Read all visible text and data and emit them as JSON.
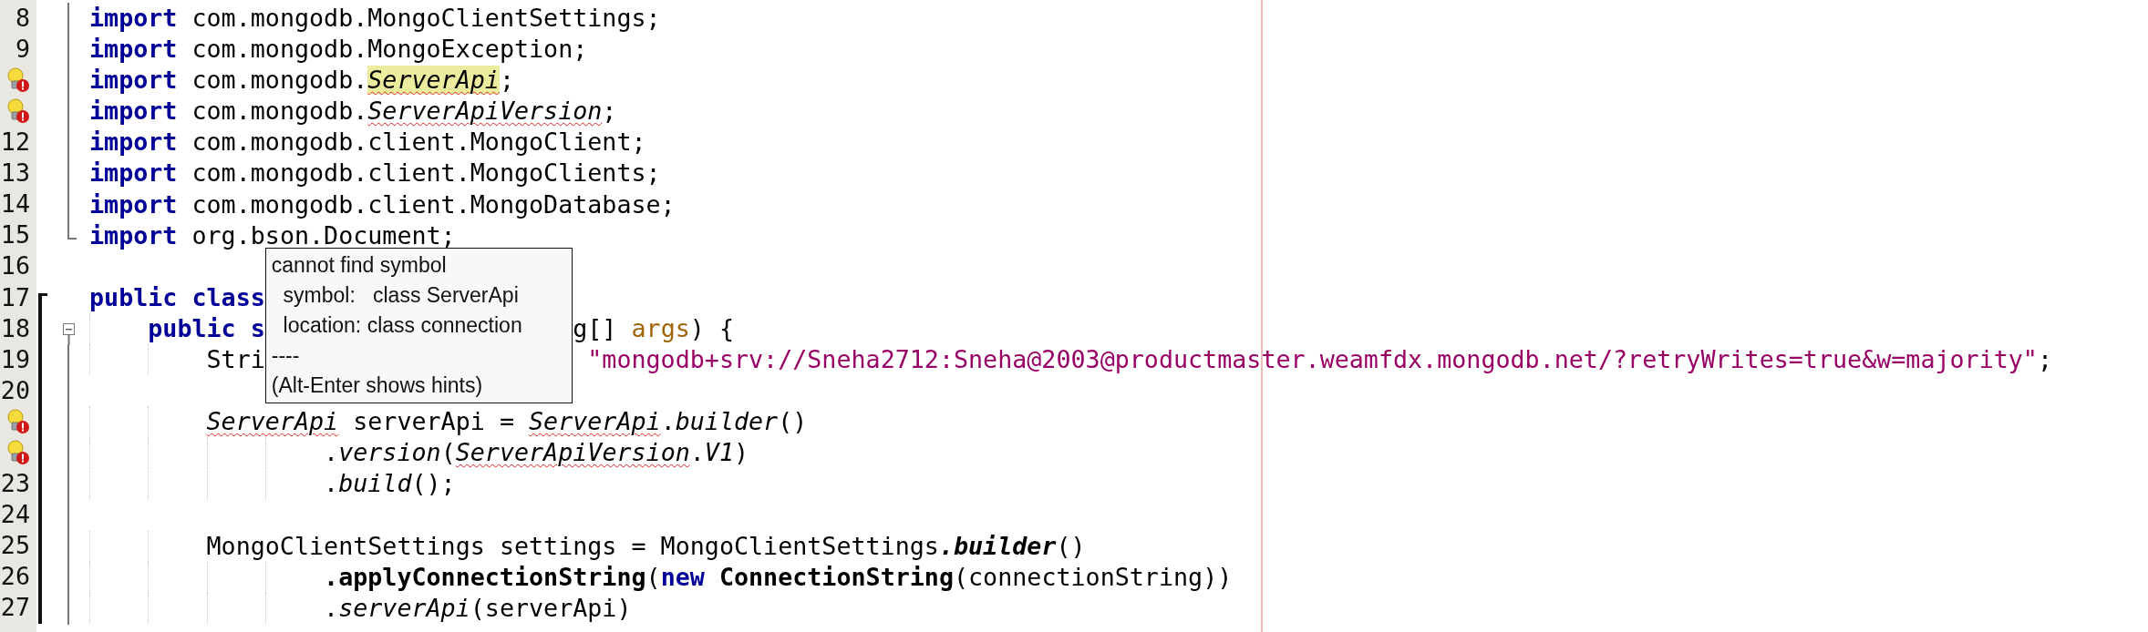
{
  "editor": {
    "lines": [
      {
        "number": "8",
        "error_hint": false,
        "fold_guide": true,
        "fold_end": false,
        "fold_toggle": false,
        "in_scope": false,
        "scope_start": false,
        "tokens": [
          {
            "kind": "kw",
            "text": "import"
          },
          {
            "kind": "plain",
            "text": " com.mongodb.MongoClientSettings;"
          }
        ]
      },
      {
        "number": "9",
        "error_hint": false,
        "fold_guide": true,
        "fold_end": false,
        "fold_toggle": false,
        "in_scope": false,
        "scope_start": false,
        "tokens": [
          {
            "kind": "kw",
            "text": "import"
          },
          {
            "kind": "plain",
            "text": " com.mongodb.MongoException;"
          }
        ]
      },
      {
        "error_hint": true,
        "fold_guide": true,
        "fold_end": false,
        "fold_toggle": false,
        "in_scope": false,
        "scope_start": false,
        "tokens": [
          {
            "kind": "kw",
            "text": "import"
          },
          {
            "kind": "plain",
            "text": " com.mongodb."
          },
          {
            "kind": "err_hl",
            "text": "ServerApi"
          },
          {
            "kind": "plain",
            "text": ";"
          }
        ]
      },
      {
        "error_hint": true,
        "fold_guide": true,
        "fold_end": false,
        "fold_toggle": false,
        "in_scope": false,
        "scope_start": false,
        "tokens": [
          {
            "kind": "kw",
            "text": "import"
          },
          {
            "kind": "plain",
            "text": " com.mongodb."
          },
          {
            "kind": "err",
            "text": "ServerApiVersion"
          },
          {
            "kind": "plain",
            "text": ";"
          }
        ]
      },
      {
        "number": "12",
        "error_hint": false,
        "fold_guide": true,
        "fold_end": false,
        "fold_toggle": false,
        "in_scope": false,
        "scope_start": false,
        "tokens": [
          {
            "kind": "kw",
            "text": "import"
          },
          {
            "kind": "plain",
            "text": " com.mongodb.client.MongoClient;"
          }
        ]
      },
      {
        "number": "13",
        "error_hint": false,
        "fold_guide": true,
        "fold_end": false,
        "fold_toggle": false,
        "in_scope": false,
        "scope_start": false,
        "tokens": [
          {
            "kind": "kw",
            "text": "import"
          },
          {
            "kind": "plain",
            "text": " com.mongodb.client.MongoClients;"
          }
        ]
      },
      {
        "number": "14",
        "error_hint": false,
        "fold_guide": true,
        "fold_end": false,
        "fold_toggle": false,
        "in_scope": false,
        "scope_start": false,
        "tokens": [
          {
            "kind": "kw",
            "text": "import"
          },
          {
            "kind": "plain",
            "text": " com.mongodb.client.MongoDatabase;"
          }
        ]
      },
      {
        "number": "15",
        "error_hint": false,
        "fold_guide": false,
        "fold_end": true,
        "fold_toggle": false,
        "in_scope": false,
        "scope_start": false,
        "tokens": [
          {
            "kind": "kw",
            "text": "import"
          },
          {
            "kind": "plain",
            "text": " org.bson.Document;"
          }
        ]
      },
      {
        "number": "16",
        "error_hint": false,
        "fold_guide": false,
        "fold_end": false,
        "fold_toggle": false,
        "in_scope": false,
        "scope_start": false
      },
      {
        "number": "17",
        "error_hint": false,
        "fold_guide": false,
        "fold_end": false,
        "fold_toggle": false,
        "in_scope": false,
        "scope_start": true,
        "tokens": [
          {
            "kind": "kw",
            "text": "public"
          },
          {
            "kind": "kw",
            "text": " class"
          }
        ]
      },
      {
        "number": "18",
        "error_hint": false,
        "fold_guide": false,
        "fold_end": false,
        "fold_toggle": true,
        "in_scope": true,
        "scope_start": false,
        "tokens": [
          {
            "kind": "kw",
            "text": "    public"
          },
          {
            "kind": "kw",
            "text": " s"
          }
        ],
        "tokens_after_tooltip": [
          {
            "kind": "plain",
            "text": "g[] "
          },
          {
            "kind": "param",
            "text": "args"
          },
          {
            "kind": "plain",
            "text": ") {"
          }
        ]
      },
      {
        "number": "19",
        "error_hint": false,
        "fold_guide": true,
        "fold_end": false,
        "fold_toggle": false,
        "in_scope": true,
        "scope_start": false,
        "tokens": [
          {
            "kind": "plain",
            "text": "        Stri"
          }
        ],
        "tokens_after_tooltip": [
          {
            "kind": "str",
            "text": " \"mongodb+srv://Sneha2712:Sneha@2003@productmaster.weamfdx.mongodb.net/?retryWrites=true&w=majority\""
          },
          {
            "kind": "plain",
            "text": ";"
          }
        ]
      },
      {
        "number": "20",
        "error_hint": false,
        "fold_guide": true,
        "fold_end": false,
        "fold_toggle": false,
        "in_scope": true,
        "scope_start": false
      },
      {
        "error_hint": true,
        "fold_guide": true,
        "fold_end": false,
        "fold_toggle": false,
        "in_scope": true,
        "scope_start": false,
        "tokens": [
          {
            "kind": "err",
            "text": "        ServerApi"
          },
          {
            "kind": "plain",
            "text": " serverApi = "
          },
          {
            "kind": "err",
            "text": "ServerApi"
          },
          {
            "kind": "plain",
            "text": "."
          },
          {
            "kind": "italic",
            "text": "builder"
          },
          {
            "kind": "plain",
            "text": "()"
          }
        ]
      },
      {
        "error_hint": true,
        "fold_guide": true,
        "fold_end": false,
        "fold_toggle": false,
        "in_scope": true,
        "scope_start": false,
        "tokens": [
          {
            "kind": "plain",
            "text": "                ."
          },
          {
            "kind": "italic",
            "text": "version"
          },
          {
            "kind": "plain",
            "text": "("
          },
          {
            "kind": "err",
            "text": "ServerApiVersion"
          },
          {
            "kind": "plain",
            "text": "."
          },
          {
            "kind": "italic",
            "text": "V1"
          },
          {
            "kind": "plain",
            "text": ")"
          }
        ]
      },
      {
        "number": "23",
        "error_hint": false,
        "fold_guide": true,
        "fold_end": false,
        "fold_toggle": false,
        "in_scope": true,
        "scope_start": false,
        "tokens": [
          {
            "kind": "plain",
            "text": "                ."
          },
          {
            "kind": "italic",
            "text": "build"
          },
          {
            "kind": "plain",
            "text": "();"
          }
        ]
      },
      {
        "number": "24",
        "error_hint": false,
        "fold_guide": true,
        "fold_end": false,
        "fold_toggle": false,
        "in_scope": true,
        "scope_start": false
      },
      {
        "number": "25",
        "error_hint": false,
        "fold_guide": true,
        "fold_end": false,
        "fold_toggle": false,
        "in_scope": true,
        "scope_start": false,
        "tokens": [
          {
            "kind": "plain",
            "text": "        MongoClientSettings settings = MongoClientSettings"
          },
          {
            "kind": "bolditalic",
            "text": ".builder"
          },
          {
            "kind": "plain",
            "text": "()"
          }
        ]
      },
      {
        "number": "26",
        "error_hint": false,
        "fold_guide": true,
        "fold_end": false,
        "fold_toggle": false,
        "in_scope": true,
        "scope_start": false,
        "tokens": [
          {
            "kind": "bold",
            "text": "                .applyConnectionString"
          },
          {
            "kind": "plain",
            "text": "("
          },
          {
            "kind": "kw",
            "text": "new"
          },
          {
            "kind": "bold",
            "text": " ConnectionString"
          },
          {
            "kind": "plain",
            "text": "(connectionString))"
          }
        ]
      },
      {
        "number": "27",
        "error_hint": false,
        "fold_guide": true,
        "fold_end": false,
        "fold_toggle": false,
        "in_scope": true,
        "scope_start": false,
        "tokens": [
          {
            "kind": "plain",
            "text": "                ."
          },
          {
            "kind": "italic",
            "text": "serverApi"
          },
          {
            "kind": "plain",
            "text": "(serverApi)"
          }
        ]
      }
    ]
  },
  "tooltip": {
    "lines": [
      "cannot find symbol",
      "  symbol:   class ServerApi",
      "  location: class connection",
      "----",
      "(Alt-Enter shows hints)"
    ]
  }
}
